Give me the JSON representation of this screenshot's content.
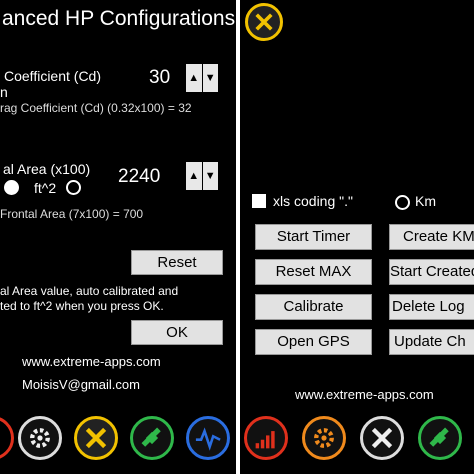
{
  "left": {
    "title": "anced HP Configurations",
    "drag_label": "Coefficient (Cd)",
    "drag_label_line2": "n",
    "drag_value": "30",
    "drag_hint": "rag Coefficient (Cd) (0.32x100) = 32",
    "area_label": "al Area (x100)",
    "area_unit": "ft^2",
    "area_value": "2240",
    "area_hint": "Frontal Area (7x100) = 700",
    "reset_label": "Reset",
    "info_line1": "al Area value, auto calibrated and",
    "info_line2": "ted to ft^2 when you press OK.",
    "ok_label": "OK",
    "website": "www.extreme-apps.com",
    "email": "MoisisV@gmail.com",
    "spin_up": "▲",
    "spin_down": "▼"
  },
  "right": {
    "xls_label": "xls coding \".\"",
    "km_label": "Km",
    "buttons": {
      "start_timer": "Start  Timer",
      "create_kml": "Create KM",
      "reset_max": "Reset MAX",
      "start_created": "Start Created",
      "calibrate": "Calibrate",
      "delete_log": "Delete Log",
      "open_gps": "Open GPS",
      "update_ch": "Update Ch"
    },
    "website": "www.extreme-apps.com"
  },
  "icons": {
    "left_dock": [
      "partial-red-icon",
      "gear-icon",
      "tools-icon",
      "satellite-icon",
      "waveform-icon"
    ],
    "right_dock": [
      "signal-bars-icon",
      "gear-icon",
      "tools-icon",
      "satellite-icon"
    ],
    "header": "tools-icon"
  },
  "colors": {
    "background": "#000000",
    "button": "#e2e2e2",
    "accent_yellow": "#f2c200",
    "accent_green": "#2fb84a",
    "accent_blue": "#2a6de0",
    "accent_orange": "#f08a1c",
    "accent_red": "#e0301c"
  }
}
